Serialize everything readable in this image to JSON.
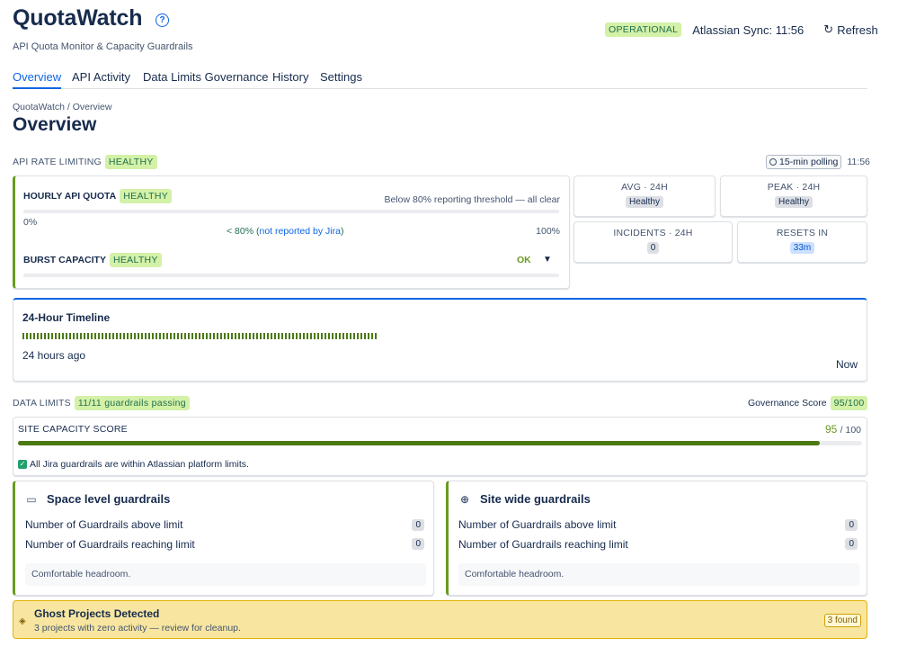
{
  "app": {
    "title": "QuotaWatch",
    "help_icon": "question-circle-icon",
    "subtitle": "API Quota Monitor & Capacity Guardrails"
  },
  "header": {
    "status": "OPERATIONAL",
    "sync": "Atlassian Sync: 11:56",
    "refresh_label": "Refresh",
    "refresh_icon": "refresh-icon"
  },
  "tabs": [
    {
      "label": "Overview",
      "active": true
    },
    {
      "label": "API Activity",
      "active": false
    },
    {
      "label": "Data Limits Governance",
      "active": false
    },
    {
      "label": "History",
      "active": false
    },
    {
      "label": "Settings",
      "active": false
    }
  ],
  "breadcrumb": "QuotaWatch / Overview",
  "page_title": "Overview",
  "api_rate": {
    "label": "API RATE LIMITING",
    "status": "HEALTHY",
    "polling": "15-min polling",
    "polling_time": "11:56"
  },
  "quota": {
    "hourly_label": "HOURLY API QUOTA",
    "hourly_status": "HEALTHY",
    "hourly_note": "Below 80% reporting threshold — all clear",
    "min_label": "0%",
    "max_label": "100%",
    "threshold_prefix": "< 80% (",
    "threshold_link": "not reported by Jira",
    "threshold_suffix": ")",
    "burst_label": "BURST CAPACITY",
    "burst_status": "HEALTHY",
    "burst_value": "OK"
  },
  "stats": [
    {
      "title": "AVG · 24H",
      "value": "Healthy"
    },
    {
      "title": "PEAK · 24H",
      "value": "Healthy"
    },
    {
      "title": "INCIDENTS · 24H",
      "value": "0"
    },
    {
      "title": "RESETS IN",
      "value": "33m"
    }
  ],
  "timeline": {
    "title": "24-Hour Timeline",
    "start_label": "24 hours ago",
    "end_label": "Now"
  },
  "data_limits": {
    "label": "DATA LIMITS",
    "badge": "11/11 guardrails passing",
    "governance_label": "Governance Score",
    "governance_value": "95/100"
  },
  "capacity": {
    "title": "SITE CAPACITY SCORE",
    "score": "95",
    "of": "/ 100",
    "fill_percent": 95,
    "note": "All Jira guardrails are within Atlassian platform limits."
  },
  "guardrails": [
    {
      "title": "Space level guardrails",
      "icon": "calendar-icon",
      "rows": [
        {
          "label": "Number of Guardrails above limit",
          "value": "0"
        },
        {
          "label": "Number of Guardrails reaching limit",
          "value": "0"
        }
      ],
      "note": "Comfortable headroom."
    },
    {
      "title": "Site wide guardrails",
      "icon": "globe-icon",
      "rows": [
        {
          "label": "Number of Guardrails above limit",
          "value": "0"
        },
        {
          "label": "Number of Guardrails reaching limit",
          "value": "0"
        }
      ],
      "note": "Comfortable headroom."
    }
  ],
  "ghost": {
    "title": "Ghost Projects Detected",
    "subtitle": "3 projects with zero activity — review for cleanup.",
    "badge": "3 found",
    "icon": "ghost-icon"
  },
  "colors": {
    "accent": "#0c66e4",
    "healthy": "#6a9a23",
    "warning_bg": "#f8e6a0"
  }
}
